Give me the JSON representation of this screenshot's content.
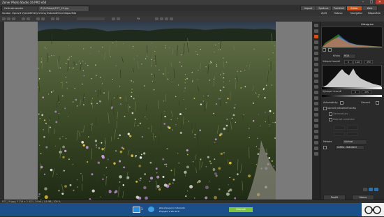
{
  "app": {
    "title": "Zoner Photo Studio 16 PRO x64"
  },
  "window_controls": {
    "minimize": "–",
    "maximize": "□",
    "close": "✕"
  },
  "tabs": {
    "document_tabs": [
      {
        "label": "Celá obrazovka",
        "active": false
      },
      {
        "label": "Z:\\3-Zdroje\\FOT_19.jpg",
        "active": true
      }
    ],
    "mode_tabs": [
      {
        "label": "Import",
        "active": false
      },
      {
        "label": "Správce",
        "active": false
      },
      {
        "label": "Prohlížeč",
        "active": false
      },
      {
        "label": "Editor",
        "active": true
      },
      {
        "label": "Web",
        "active": false
      }
    ]
  },
  "menu": {
    "items": [
      "Soubor",
      "Upravit",
      "Vybrat",
      "Efekty",
      "Vrstvy",
      "Zobrazit",
      "Okno",
      "Nápověda"
    ],
    "right_items": [
      "Zpět",
      "Hotovo",
      "Navigátor",
      "Nápověda"
    ]
  },
  "toolbar": {
    "zoom": "Fit",
    "colors": {
      "accent": "#d0541a"
    }
  },
  "panel": {
    "histogram_title": "Histogram",
    "levels": {
      "curve_label": "Křivky",
      "channel": "RGB",
      "input_label": "Vstupní úrovně",
      "input_values": [
        "0",
        "1,00",
        "255"
      ],
      "output_label": "Výstupní úrovně",
      "output_values": [
        "0",
        "255"
      ]
    },
    "auto_label": "Automaticky",
    "reset_label": "Obnovit",
    "options": [
      "Upravit jednotlivé kanály",
      "Zachovat jas",
      "Zobrazit orezávání"
    ],
    "method_label": "Metoda",
    "method_value": "Výchozí",
    "profile_value": "Světlo - Standard",
    "footer_buttons": [
      "Použít",
      "Storno"
    ]
  },
  "status": {
    "text": "FOT_19.jpg | 3 216 × 2 412 | 24 bit | 1,8 MB | 100 %"
  },
  "taskbar": {
    "notification_line1": "Jste připojeni k internetu",
    "notification_line2": "Připojení k síti Wi-Fi",
    "center_button": "Zobrazit"
  }
}
